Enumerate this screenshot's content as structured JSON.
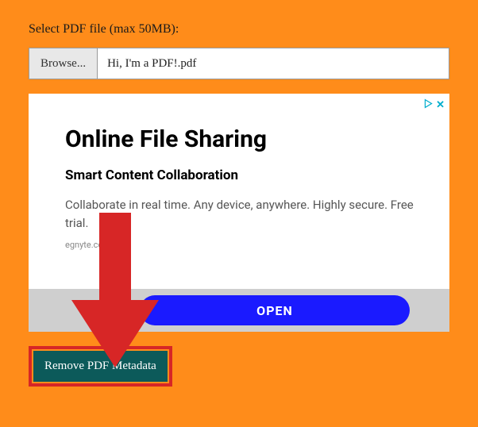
{
  "file_picker": {
    "label": "Select PDF file (max 50MB):",
    "browse_label": "Browse...",
    "filename": "Hi, I'm a PDF!.pdf"
  },
  "ad": {
    "title": "Online File Sharing",
    "subtitle": "Smart Content Collaboration",
    "body_line1": "Collaborate in real time. Any device, anywhere. Highly secure.",
    "body_line2": "Free trial.",
    "source": "egnyte.com",
    "cta": "OPEN",
    "close_symbol": "✕"
  },
  "action": {
    "remove_label": "Remove PDF Metadata"
  },
  "colors": {
    "page_bg": "#ff8c1a",
    "remove_btn_bg": "#0c5a5a",
    "highlight_border": "#d72626",
    "cta_bg": "#1a1aff",
    "arrow": "#d72626"
  }
}
